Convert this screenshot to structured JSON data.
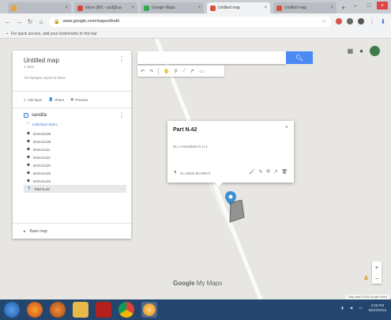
{
  "browser": {
    "tabs": [
      {
        "title": "",
        "active": false,
        "fav_color": "#e8a33d"
      },
      {
        "title": "Inbox (80) - ucd@ua",
        "active": false,
        "fav_color": "#d44638"
      },
      {
        "title": "Google Maps",
        "active": false,
        "fav_color": "#34a853"
      },
      {
        "title": "Untitled map",
        "active": true,
        "fav_color": "#d94f3d"
      },
      {
        "title": "Untitled map",
        "active": false,
        "fav_color": "#d94f3d"
      }
    ],
    "url": "www.google.com/maps/d/edit",
    "bookmarks_hint": "For quick access, add your bookmarks to this bar"
  },
  "panel": {
    "title": "Untitled map",
    "views": "1 view",
    "saved_status": "All changes saved in Drive",
    "actions": {
      "add_layer": "Add layer",
      "share": "Share",
      "preview": "Preview"
    },
    "layer": {
      "name": "sandila",
      "styles_label": "Individual styles",
      "features": [
        "524141100",
        "524141105",
        "524141111",
        "524141112",
        "524141119",
        "524141126",
        "524141142",
        "Part N.42"
      ],
      "selected_feature": "Part N.42"
    },
    "base_map": "Base map"
  },
  "search": {
    "placeholder": "",
    "button": "Search"
  },
  "card": {
    "title": "Part N.42",
    "description": "M.J.J.Sewthara R.H.1",
    "coords": "21.13605,90.89073"
  },
  "watermark": {
    "brand": "Google",
    "product": "My Maps"
  },
  "attribution": "Map data ©2016 Google  Terms",
  "taskbar": {
    "apps": [
      "windows-start",
      "firefox",
      "media",
      "explorer",
      "pdf",
      "chrome",
      "tor"
    ],
    "time": "3:38 PM",
    "date": "06/23/2016"
  },
  "colors": {
    "accent": "#4a89f3",
    "taskbar": "#23456e",
    "pin": "#3b8fd1"
  }
}
